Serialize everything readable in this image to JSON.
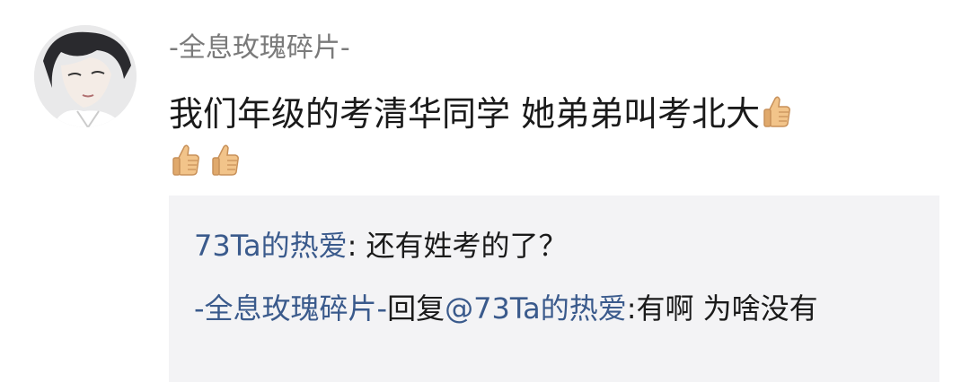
{
  "comment": {
    "username": "-全息玫瑰碎片-",
    "text": "我们年级的考清华同学 她弟弟叫考北大",
    "emoji": [
      "thumbs-up-icon",
      "thumbs-up-icon",
      "thumbs-up-icon"
    ]
  },
  "replies": [
    {
      "author": "73Ta的热爱",
      "separator": ": ",
      "text": "还有姓考的了？"
    },
    {
      "author": "-全息玫瑰碎片-",
      "reply_word": "回复",
      "mention": "@73Ta的热爱",
      "separator": ":",
      "text": "有啊 为啥没有"
    }
  ],
  "colors": {
    "link": "#3a5a8c",
    "username": "#7a7a7a",
    "reply_bg": "#f3f3f5"
  }
}
